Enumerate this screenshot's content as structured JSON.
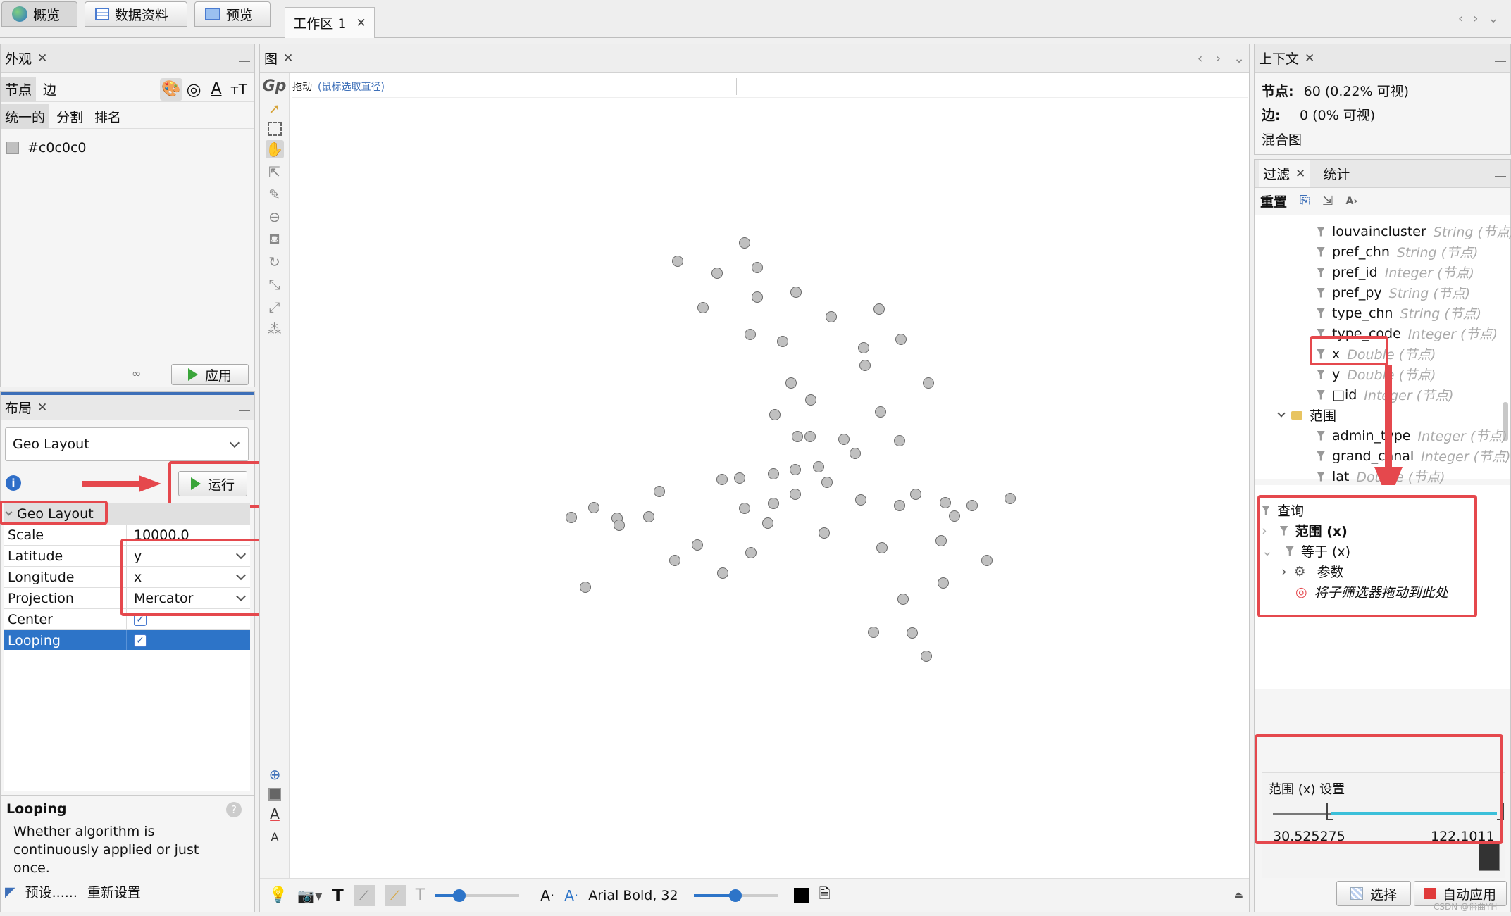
{
  "top_tabs": [
    {
      "label": "概览",
      "icon": "globe-icon"
    },
    {
      "label": "数据资料",
      "icon": "table-icon"
    },
    {
      "label": "预览",
      "icon": "monitor-icon"
    }
  ],
  "workspace_tab": {
    "label": "工作区 1",
    "close": "✕"
  },
  "appearance": {
    "title": "外观",
    "tabs": [
      "节点",
      "边"
    ],
    "subtabs": [
      "统一的",
      "分割",
      "排名"
    ],
    "color_value": "#c0c0c0",
    "apply_label": "应用"
  },
  "layout": {
    "title": "布局",
    "algorithm": "Geo Layout",
    "run_label": "运行",
    "section": "Geo Layout",
    "properties": [
      {
        "key": "Scale",
        "value": "10000.0"
      },
      {
        "key": "Latitude",
        "value": "y"
      },
      {
        "key": "Longitude",
        "value": "x"
      },
      {
        "key": "Projection",
        "value": "Mercator"
      },
      {
        "key": "Center",
        "value": "checked"
      },
      {
        "key": "Looping",
        "value": "checked"
      }
    ],
    "desc_title": "Looping",
    "desc_text": "Whether algorithm is continuously applied or just once.",
    "presets_label": "预设......",
    "reset_label": "重新设置"
  },
  "graph": {
    "title": "图",
    "mode_label": "拖动",
    "mode_hint": "(鼠标选取直径)",
    "font_label": "Arial Bold, 32"
  },
  "context": {
    "title": "上下文",
    "nodes_label": "节点:",
    "nodes_value": "60 (0.22% 可视)",
    "edges_label": "边:",
    "edges_value": "0 (0% 可视)",
    "graph_type": "混合图"
  },
  "filter": {
    "tab_filter": "过滤",
    "tab_stats": "统计",
    "reset_label": "重置",
    "attributes": [
      {
        "name": "louvaincluster",
        "type": "String (节点)"
      },
      {
        "name": "pref_chn",
        "type": "String (节点)"
      },
      {
        "name": "pref_id",
        "type": "Integer (节点)"
      },
      {
        "name": "pref_py",
        "type": "String (节点)"
      },
      {
        "name": "type_chn",
        "type": "String (节点)"
      },
      {
        "name": "type_code",
        "type": "Integer (节点)"
      },
      {
        "name": "x",
        "type": "Double (节点)"
      },
      {
        "name": "y",
        "type": "Double (节点)"
      },
      {
        "name": "□id",
        "type": "Integer (节点)"
      }
    ],
    "range_folder": "范围",
    "range_attributes": [
      {
        "name": "admin_type",
        "type": "Integer (节点)"
      },
      {
        "name": "grand_canal",
        "type": "Integer (节点)"
      },
      {
        "name": "lat",
        "type": "Double (节点)"
      }
    ],
    "query_label": "查询",
    "queries": [
      "范围 (x)",
      "等于 (x)",
      "参数"
    ],
    "drop_hint": "将子筛选器拖动到此处",
    "settings_title": "范围 (x) 设置",
    "range_min": "30.525275",
    "range_max": "122.1011",
    "select_label": "选择",
    "auto_apply_label": "自动应用"
  },
  "watermark": "CSDN @俗曲YH"
}
